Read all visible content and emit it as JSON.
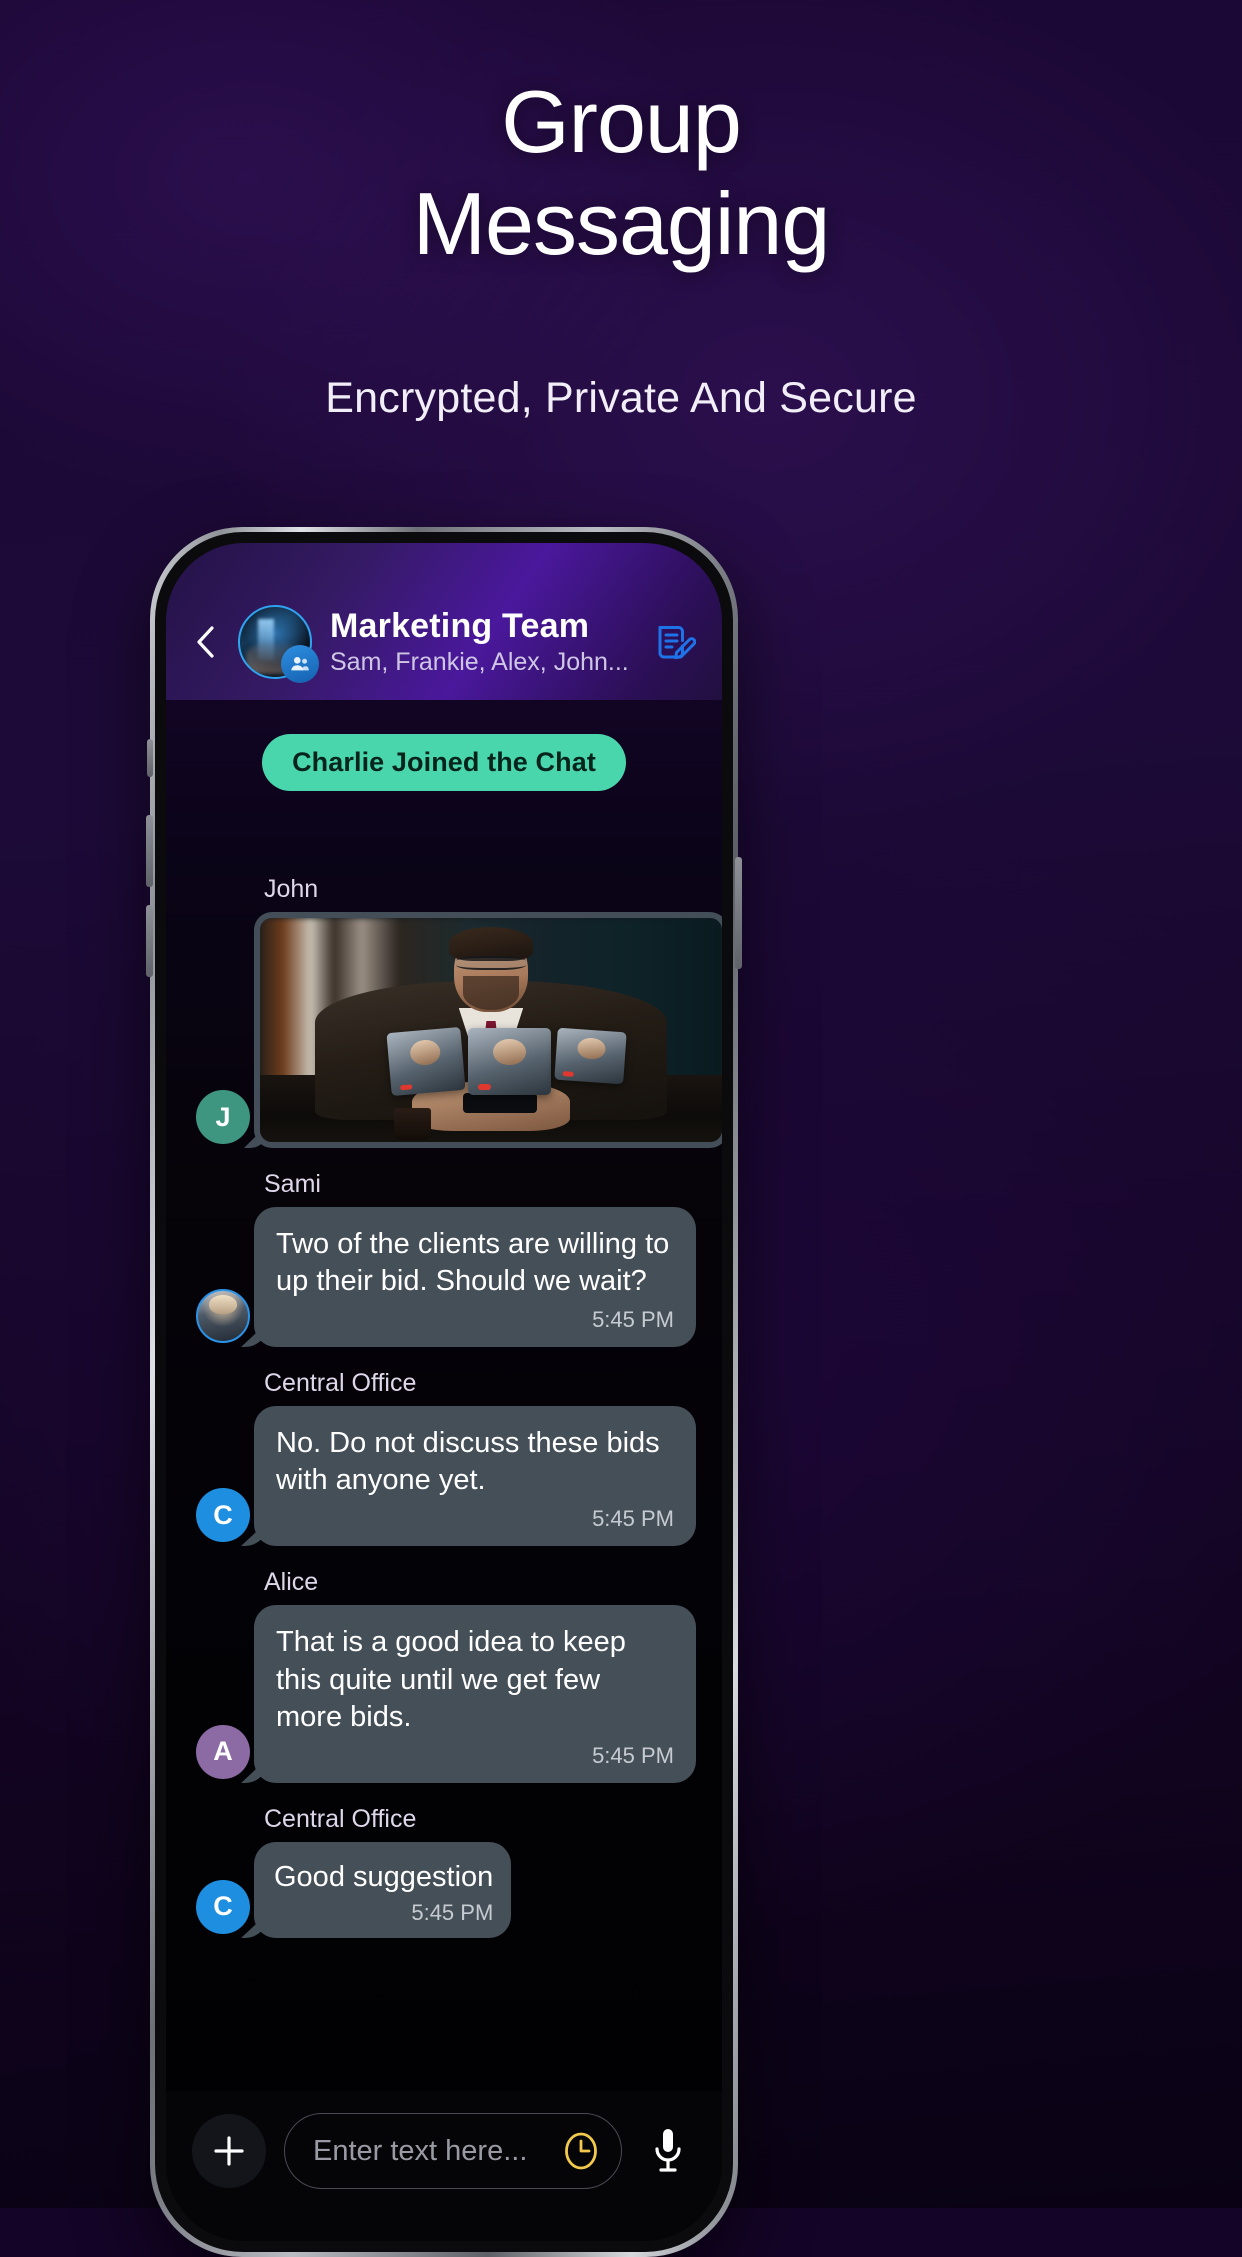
{
  "promo": {
    "headline_line1": "Group",
    "headline_line2": "Messaging",
    "subheadline": "Encrypted, Private And Secure"
  },
  "colors": {
    "accent_banner": "#4AD6AC",
    "bubble": "#454F58",
    "header_gradient_start": "#241246",
    "header_gradient_end": "#4A189C",
    "compose_icon": "#1E73E8",
    "clock_icon": "#F2C94C",
    "background": "#140427"
  },
  "chat_header": {
    "back_icon": "chevron-left-icon",
    "avatar_icon": "group-avatar",
    "avatar_badge_icon": "group-members-icon",
    "title": "Marketing Team",
    "members": "Sam, Frankie, Alex, John...",
    "compose_icon": "compose-note-icon"
  },
  "system_banner": {
    "text": "Charlie Joined the Chat"
  },
  "messages": [
    {
      "sender": "John",
      "avatar_initial": "J",
      "avatar_color": "#3F9680",
      "type": "image",
      "image_alt": "Man in suit on a group video call holding a phone",
      "time": ""
    },
    {
      "sender": "Sami",
      "avatar_initial": "",
      "avatar_color": "#8FA3B8",
      "type": "text",
      "text": "Two of the clients are willing to up their bid. Should we wait?",
      "time": "5:45 PM"
    },
    {
      "sender": "Central Office",
      "avatar_initial": "C",
      "avatar_color": "#1E8FE0",
      "type": "text",
      "text": "No. Do not discuss these bids with anyone yet.",
      "time": "5:45 PM"
    },
    {
      "sender": "Alice",
      "avatar_initial": "A",
      "avatar_color": "#8C6BA4",
      "type": "text",
      "text": "That is a good idea to keep this quite until we get few more bids.",
      "time": "5:45 PM"
    },
    {
      "sender": "Central Office",
      "avatar_initial": "C",
      "avatar_color": "#1E8FE0",
      "type": "text",
      "text": "Good suggestion",
      "time": "5:45 PM"
    }
  ],
  "input_bar": {
    "add_icon": "plus-icon",
    "placeholder": "Enter text here...",
    "schedule_icon": "clock-icon",
    "mic_icon": "microphone-icon"
  }
}
